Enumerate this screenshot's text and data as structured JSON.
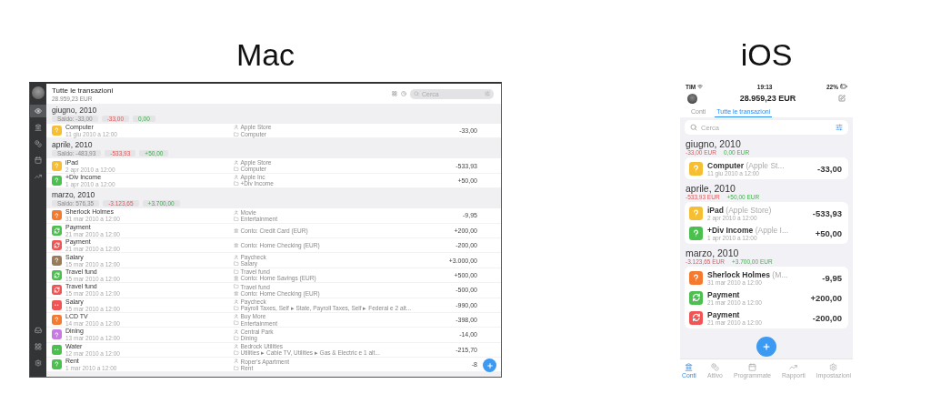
{
  "headings": [
    "Mac",
    "iOS"
  ],
  "mac": {
    "sidebar": {
      "top": [
        {
          "kind": "eye",
          "selected": true
        },
        {
          "kind": "bank",
          "selected": false
        },
        {
          "kind": "coins",
          "selected": false
        },
        {
          "kind": "calendar",
          "selected": false
        },
        {
          "kind": "chart",
          "selected": false
        }
      ],
      "bottom": [
        {
          "kind": "tray",
          "selected": false
        },
        {
          "kind": "grid",
          "selected": false
        },
        {
          "kind": "settings",
          "selected": false
        }
      ]
    },
    "title": "Tutte le transazioni",
    "subtitle": "28.959,23 EUR",
    "search": {
      "placeholder": "Cerca"
    },
    "sections": [
      {
        "month": "giugno, 2010",
        "balance": "Saldo: -33,00",
        "expenses": "-33,00",
        "income": "0,00",
        "rows": [
          {
            "name": "Computer",
            "date": "11 giu 2010 a 12:00",
            "kind": "question",
            "color": "#f6be32",
            "details": [
              {
                "kind": "payee",
                "text": "Apple Store"
              },
              {
                "kind": "category",
                "text": "Computer"
              }
            ],
            "amount": "-33,00"
          }
        ]
      },
      {
        "month": "aprile, 2010",
        "balance": "Saldo: -483,93",
        "expenses": "-533,93",
        "income": "+50,00",
        "rows": [
          {
            "name": "iPad",
            "date": "2 apr 2010 a 12:00",
            "kind": "question",
            "color": "#f6be32",
            "details": [
              {
                "kind": "payee",
                "text": "Apple Store"
              },
              {
                "kind": "category",
                "text": "Computer"
              }
            ],
            "amount": "-533,93"
          },
          {
            "name": "+Div Income",
            "date": "1 apr 2010 a 12:00",
            "kind": "question",
            "color": "#4cc04f",
            "details": [
              {
                "kind": "payee",
                "text": "Apple Inc"
              },
              {
                "kind": "category",
                "text": "+Div Income"
              }
            ],
            "amount": "+50,00"
          }
        ]
      },
      {
        "month": "marzo, 2010",
        "balance": "Saldo: 576,35",
        "expenses": "-3.123,65",
        "income": "+3.700,00",
        "rows": [
          {
            "name": "Sherlock Holmes",
            "date": "31 mar 2010 a 12:00",
            "kind": "question",
            "color": "#f47a30",
            "details": [
              {
                "kind": "payee",
                "text": "Movie"
              },
              {
                "kind": "category",
                "text": "Entertainment"
              }
            ],
            "amount": "-9,95"
          },
          {
            "name": "Payment",
            "date": "21 mar 2010 a 12:00",
            "kind": "transfer",
            "color": "#4cc04f",
            "details": [
              {
                "kind": "account",
                "text": "Conto: Credit Card (EUR)"
              }
            ],
            "amount": "+200,00"
          },
          {
            "name": "Payment",
            "date": "21 mar 2010 a 12:00",
            "kind": "transfer",
            "color": "#f05454",
            "details": [
              {
                "kind": "account",
                "text": "Conto: Home Checking (EUR)"
              }
            ],
            "amount": "-200,00"
          },
          {
            "name": "Salary",
            "date": "15 mar 2010 a 12:00",
            "kind": "question",
            "color": "#9a7b58",
            "details": [
              {
                "kind": "payee",
                "text": "Paycheck"
              },
              {
                "kind": "category",
                "text": "Salary"
              }
            ],
            "amount": "+3.000,00"
          },
          {
            "name": "Travel fund",
            "date": "15 mar 2010 a 12:00",
            "kind": "transfer",
            "color": "#4cc04f",
            "details": [
              {
                "kind": "category",
                "text": "Travel fund"
              },
              {
                "kind": "account",
                "text": "Conto: Home Savings (EUR)"
              }
            ],
            "amount": "+500,00"
          },
          {
            "name": "Travel fund",
            "date": "15 mar 2010 a 12:00",
            "kind": "transfer",
            "color": "#f05454",
            "details": [
              {
                "kind": "category",
                "text": "Travel fund"
              },
              {
                "kind": "account",
                "text": "Conto: Home Checking (EUR)"
              }
            ],
            "amount": "-500,00"
          },
          {
            "name": "Salary",
            "date": "15 mar 2010 a 12:00",
            "kind": "split",
            "color": "#f05454",
            "details": [
              {
                "kind": "payee",
                "text": "Paycheck"
              },
              {
                "kind": "category",
                "text": "Payroll Taxes, Self ▸ State, Payroll Taxes, Self ▸ Federal e 2 alt..."
              }
            ],
            "amount": "-990,00"
          },
          {
            "name": "LCD TV",
            "date": "14 mar 2010 a 12:00",
            "kind": "question",
            "color": "#f47a30",
            "details": [
              {
                "kind": "payee",
                "text": "Buy More"
              },
              {
                "kind": "category",
                "text": "Entertainment"
              }
            ],
            "amount": "-398,00"
          },
          {
            "name": "Dining",
            "date": "13 mar 2010 a 12:00",
            "kind": "question",
            "color": "#c57be0",
            "details": [
              {
                "kind": "payee",
                "text": "Central Park"
              },
              {
                "kind": "category",
                "text": "Dining"
              }
            ],
            "amount": "-14,00"
          },
          {
            "name": "Water",
            "date": "12 mar 2010 a 12:00",
            "kind": "split",
            "color": "#4cc04f",
            "details": [
              {
                "kind": "payee",
                "text": "Bedrock Utilities"
              },
              {
                "kind": "category",
                "text": "Utilities ▸ Cable TV, Utilities ▸ Gas & Electric e 1 alt..."
              }
            ],
            "amount": "-215,70"
          },
          {
            "name": "Rent",
            "date": "1 mar 2010 a 12:00",
            "kind": "question",
            "color": "#4cc04f",
            "details": [
              {
                "kind": "payee",
                "text": "Roper's Apartment"
              },
              {
                "kind": "category",
                "text": "Rent"
              }
            ],
            "amount": "-8"
          }
        ]
      }
    ]
  },
  "ios": {
    "status": {
      "carrier": "TIM",
      "time": "19:13",
      "battery": "22%"
    },
    "total": "28.959,23 EUR",
    "tabs": [
      {
        "label": "Conti",
        "selected": false
      },
      {
        "label": "Tutte le transazioni",
        "selected": true
      }
    ],
    "search": {
      "placeholder": "Cerca"
    },
    "sections": [
      {
        "month": "giugno, 2010",
        "expenses": "-33,00 EUR",
        "income": "0,00 EUR",
        "rows": [
          {
            "name": "Computer",
            "payee": "(Apple St...",
            "date": "11 giu 2010 a 12:00",
            "kind": "question",
            "color": "#f6be32",
            "amount": "-33,00"
          }
        ]
      },
      {
        "month": "aprile, 2010",
        "expenses": "-533,93 EUR",
        "income": "+50,00 EUR",
        "rows": [
          {
            "name": "iPad",
            "payee": "(Apple Store)",
            "date": "2 apr 2010 a 12:00",
            "kind": "question",
            "color": "#f6be32",
            "amount": "-533,93"
          },
          {
            "name": "+Div Income",
            "payee": "(Apple I...",
            "date": "1 apr 2010 a 12:00",
            "kind": "question",
            "color": "#4cc04f",
            "amount": "+50,00"
          }
        ]
      },
      {
        "month": "marzo, 2010",
        "expenses": "-3.123,65 EUR",
        "income": "+3.700,00 EUR",
        "rows": [
          {
            "name": "Sherlock Holmes",
            "payee": "(M...",
            "date": "31 mar 2010 a 12:00",
            "kind": "question",
            "color": "#f47a30",
            "amount": "-9,95"
          },
          {
            "name": "Payment",
            "payee": "",
            "date": "21 mar 2010 a 12:00",
            "kind": "transfer",
            "color": "#4cc04f",
            "amount": "+200,00"
          },
          {
            "name": "Payment",
            "payee": "",
            "date": "21 mar 2010 a 12:00",
            "kind": "transfer",
            "color": "#f05454",
            "amount": "-200,00"
          }
        ]
      }
    ],
    "bottom_tabs": [
      {
        "kind": "bank",
        "label": "Conti",
        "selected": true
      },
      {
        "kind": "coins",
        "label": "Attivo",
        "selected": false
      },
      {
        "kind": "calendar",
        "label": "Programmate",
        "selected": false
      },
      {
        "kind": "chart",
        "label": "Rapporti",
        "selected": false
      },
      {
        "kind": "settings",
        "label": "Impostazioni",
        "selected": false
      }
    ]
  }
}
